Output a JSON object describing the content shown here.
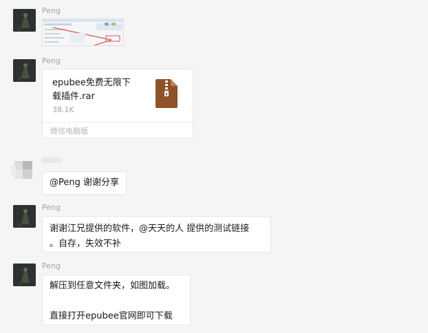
{
  "messages": [
    {
      "sender": "Peng",
      "type": "image"
    },
    {
      "sender": "Peng",
      "type": "file",
      "file_name": "epubee免费无限下载插件.rar",
      "file_name_line1": "epubee免费无限下",
      "file_name_line2": "载插件.rar",
      "file_size": "38.1K",
      "source": "微信电脑版",
      "file_icon_color": "#8f532a"
    },
    {
      "sender": "",
      "type": "text",
      "text": "@Peng 谢谢分享"
    },
    {
      "sender": "Peng",
      "type": "text",
      "line1": "谢谢江兄提供的软件，@天天的人 提供的测试链接",
      "line2": "。自存，失效不补"
    },
    {
      "sender": "Peng",
      "type": "text",
      "line1": "解压到任意文件夹，如图加载。",
      "line2": "",
      "line3": "直接打开epubee官网即可下载"
    }
  ],
  "colors": {
    "background": "#f5f5f5",
    "bubble": "#ffffff",
    "sender_name": "#a3a3a3"
  }
}
